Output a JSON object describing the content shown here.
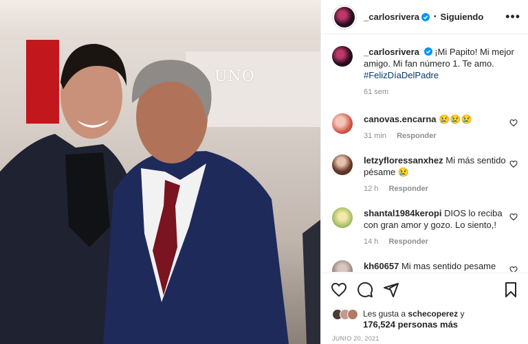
{
  "header": {
    "username": "_carlosrivera",
    "separator": "•",
    "follow_label": "Siguiendo",
    "more_icon": "more-horizontal-icon"
  },
  "photo": {
    "sign_text": "UNO"
  },
  "caption": {
    "username": "_carlosrivera",
    "text": "¡Mi Papito! Mi mejor amigo. Mi fan número 1. Te amo.",
    "hashtag": "#FelizDíaDelPadre",
    "time": "61 sem"
  },
  "comments": [
    {
      "username": "canovas.encarna",
      "text": "😢😢😢",
      "time": "31 min",
      "reply": "Responder"
    },
    {
      "username": "letzyfloressanxhez",
      "text": "Mi más sentido pésame 😢",
      "time": "12 h",
      "reply": "Responder"
    },
    {
      "username": "shantal1984keropi",
      "text": "DIOS lo reciba con gran amor y gozo. Lo siento,!",
      "time": "14 h",
      "reply": "Responder"
    },
    {
      "username": "kh60657",
      "text": "Mi mas sentido pesame",
      "time": "",
      "reply": ""
    }
  ],
  "likes": {
    "prefix": "Les gusta a",
    "user": "schecoperez",
    "conj": "y",
    "count": "176,524 personas más"
  },
  "date": "JUNIO 20, 2021",
  "colors": {
    "link": "#00376b",
    "verified": "#0095f6",
    "muted": "#8e8e8e"
  }
}
